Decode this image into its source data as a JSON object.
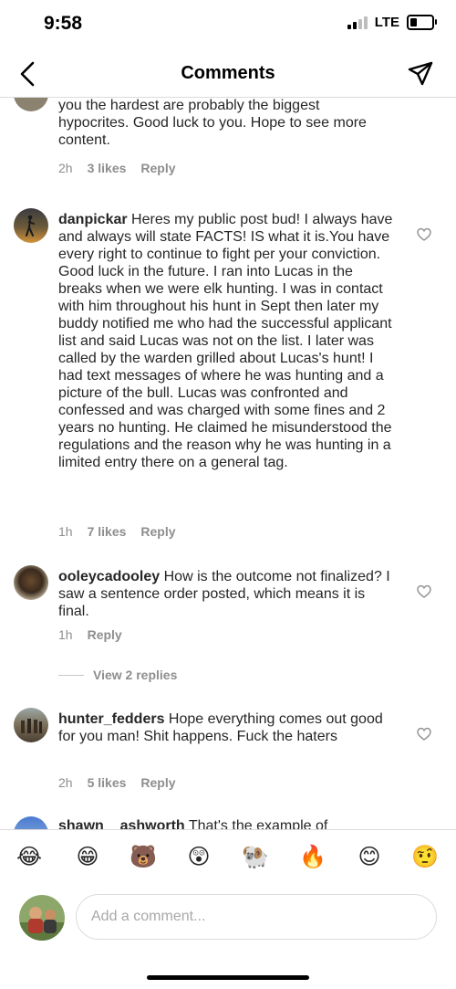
{
  "status_bar": {
    "time": "9:58",
    "network": "LTE"
  },
  "header": {
    "title": "Comments",
    "back_icon": "chevron-left-icon",
    "share_icon": "paper-plane-icon"
  },
  "comments": [
    {
      "username": "",
      "text": "you the hardest are probably the biggest hypocrites. Good luck to you. Hope to see more content.",
      "time": "2h",
      "likes": "3 likes",
      "reply": "Reply"
    },
    {
      "username": "danpickar",
      "text": "Heres my public post bud! I always have and always will state FACTS! IS what it is.You have every right to continue to fight per your conviction. Good luck in the future.  I ran into Lucas in the breaks when we were elk hunting. I was in contact with him throughout his hunt in Sept then later my  buddy notified me who had the successful applicant list and said Lucas was not on the list. I later was called by the warden grilled about Lucas's hunt! I had text messages of where he was hunting and a picture of the bull. Lucas was confronted and confessed and was charged with some fines and 2 years no hunting. He claimed he misunderstood the regulations and the reason why he was hunting in a limited entry there on a general tag.",
      "time": "1h",
      "likes": "7 likes",
      "reply": "Reply"
    },
    {
      "username": "ooleycadooley",
      "text": "How is the outcome not finalized?  I saw a sentence order posted, which means it is final.",
      "time": "1h",
      "reply": "Reply",
      "view_replies": "View 2 replies"
    },
    {
      "username": "hunter_fedders",
      "text": "Hope everything comes out good for you man! Shit happens.  Fuck the haters",
      "time": "2h",
      "likes": "5 likes",
      "reply": "Reply"
    },
    {
      "username": "shawn__ashworth",
      "text": "That's the example of"
    }
  ],
  "emoji_bar": [
    "😂",
    "😁",
    "🐻",
    "😲",
    "🐏",
    "🔥",
    "😊",
    "🤨"
  ],
  "comment_input": {
    "placeholder": "Add a comment..."
  },
  "colors": {
    "text": "#262626",
    "meta": "#8e8e8e",
    "divider": "#dbdbdb"
  }
}
